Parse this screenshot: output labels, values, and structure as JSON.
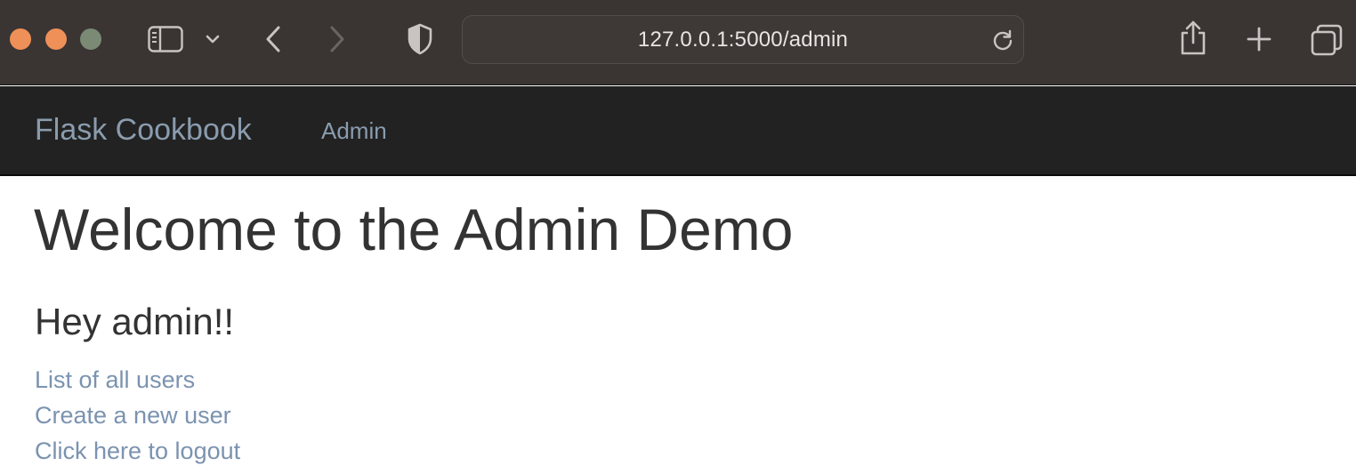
{
  "browser": {
    "url": "127.0.0.1:5000/admin",
    "traffic_colors": {
      "close": "#ee9058",
      "minimize": "#ee9058",
      "maximize": "#7b8a74"
    },
    "icons": {
      "sidebar": "sidebar-icon",
      "sidebar_menu": "chevron-down-icon",
      "back": "chevron-left-icon",
      "forward": "chevron-right-icon",
      "privacy": "shield-icon",
      "reload": "reload-icon",
      "share": "share-icon",
      "new_tab": "plus-icon",
      "tab_overview": "tabs-icon"
    }
  },
  "navbar": {
    "brand": "Flask Cookbook",
    "links": [
      {
        "label": "Admin"
      }
    ],
    "colors": {
      "background": "#222222",
      "link": "#8a9cae"
    }
  },
  "main": {
    "title": "Welcome to the Admin Demo",
    "greeting": "Hey admin!!",
    "links": [
      {
        "label": "List of all users"
      },
      {
        "label": "Create a new user"
      },
      {
        "label": "Click here to logout"
      }
    ],
    "colors": {
      "text": "#333333",
      "link": "#7b93b0"
    }
  }
}
